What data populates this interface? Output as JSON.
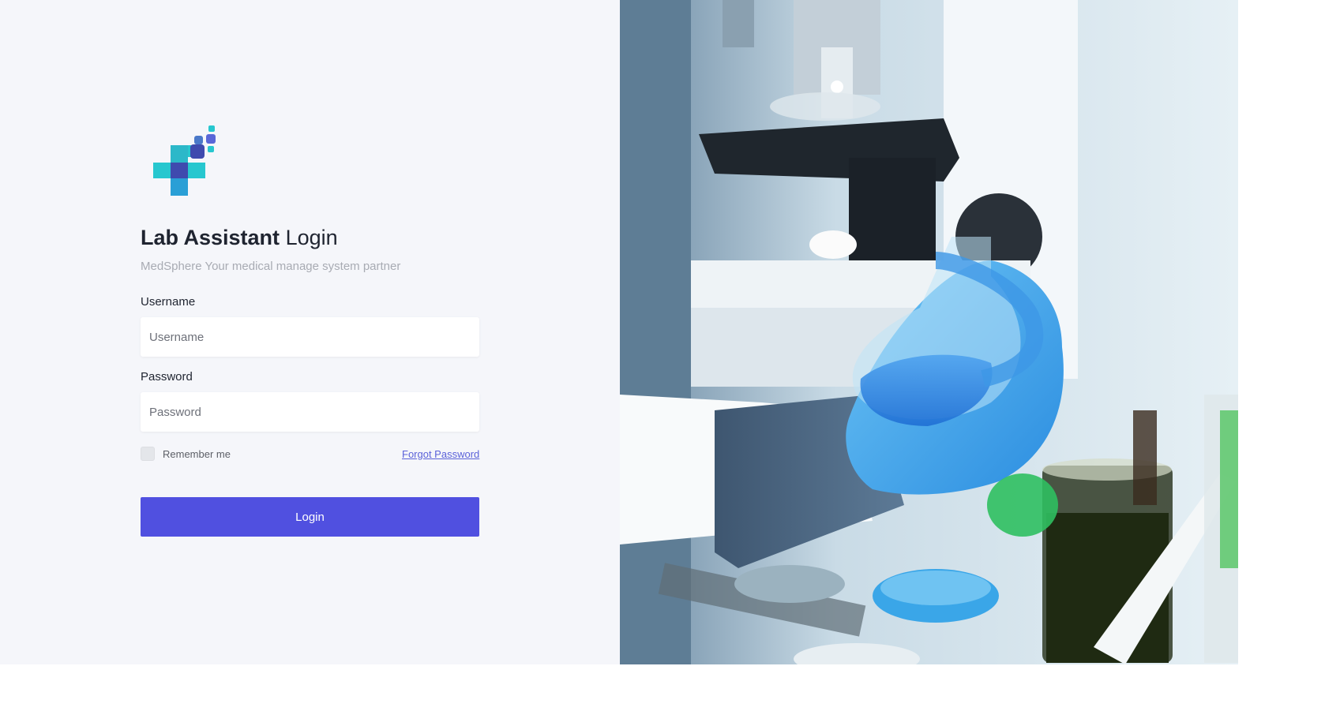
{
  "brand": {
    "logo_icon": "medical-cross-logo-icon",
    "colors": {
      "teal": "#27c7cf",
      "blue": "#2a9fd6",
      "indigo": "#3f4aae",
      "violet": "#5a67d8"
    }
  },
  "login": {
    "title_strong": "Lab Assistant",
    "title_light": "Login",
    "subtitle": "MedSphere Your medical manage system partner",
    "username_label": "Username",
    "username_placeholder": "Username",
    "password_label": "Password",
    "password_placeholder": "Password",
    "remember_label": "Remember me",
    "forgot_label": "Forgot Password",
    "submit_label": "Login"
  },
  "accent_color": "#5050e0",
  "hero_image": {
    "subject": "lab-scientist-with-flask-image"
  }
}
